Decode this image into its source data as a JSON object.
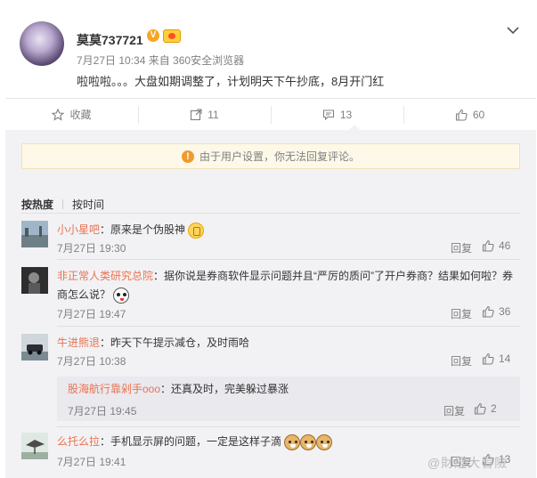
{
  "post": {
    "author": "莫莫737721",
    "meta": "7月27日 10:34 来自 360安全浏览器",
    "text": "啦啦啦。。。大盘如期调整了，计划明天下午抄底，8月开门红",
    "vip_mark": "V"
  },
  "actions": {
    "favorite": "收藏",
    "repost_count": "11",
    "comment_count": "13",
    "like_count": "60"
  },
  "notice": {
    "text": "由于用户设置，你无法回复评论。",
    "icon": "warning-icon"
  },
  "sort_tabs": {
    "hot": "按热度",
    "time": "按时间"
  },
  "comments": [
    {
      "name": "小小星吧",
      "text": "：原来是个伪股神",
      "time": "7月27日 19:30",
      "reply": "回复",
      "likes": "46"
    },
    {
      "name": "非正常人类研究总院",
      "text": "：据你说是券商软件显示问题并且“严厉的质问”了开户券商？结果如何啦？券商怎么说？",
      "time": "7月27日 19:47",
      "reply": "回复",
      "likes": "36"
    },
    {
      "name": "牛进熊退",
      "text": "：昨天下午提示减仓，及时雨哈",
      "time": "7月27日 10:38",
      "reply": "回复",
      "likes": "14"
    },
    {
      "name": "么托么拉",
      "text": "：手机显示屏的问题，一定是这样子滴",
      "time": "7月27日 19:41",
      "reply": "回复",
      "likes": "13"
    }
  ],
  "sub_reply": {
    "name": "股海航行靠剁手ooo",
    "text": "：还真及时，完美躲过暴涨",
    "time": "7月27日 19:45",
    "reply": "回复",
    "likes": "2"
  },
  "watermark": "@財經大冒險",
  "colors": {
    "link": "#eb7350",
    "panel_bg": "#f2f2f5",
    "notice_bg": "#fdf8e8"
  }
}
